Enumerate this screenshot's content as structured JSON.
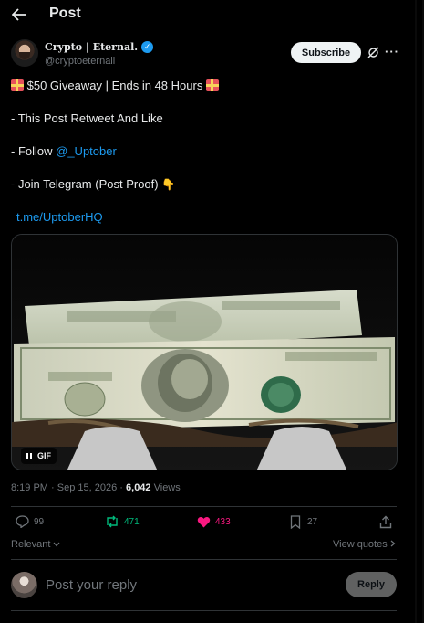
{
  "header": {
    "title": "Post",
    "back_icon": "arrow-left-icon"
  },
  "author": {
    "name": "Crypto | Eternal.",
    "handle": "@cryptoeternall",
    "verified_color": "#1d9bf0",
    "subscribe_label": "Subscribe"
  },
  "post": {
    "line1": "$50 Giveaway | Ends in 48 Hours",
    "line2": "- This Post Retweet And Like",
    "line3_prefix": "- Follow ",
    "line3_link": "@_Uptober",
    "line4": "- Join Telegram (Post Proof)",
    "line5_link": "t.me/UptoberHQ",
    "media_badge": "GIF"
  },
  "meta": {
    "time": "8:19 PM",
    "date": "Sep 15, 2026",
    "views_count": "6,042",
    "views_label": "Views"
  },
  "actions": {
    "replies": "99",
    "reposts": "471",
    "likes": "433",
    "bookmarks": "27",
    "repost_color": "#00ba7c",
    "like_color": "#f91880"
  },
  "sort": {
    "relevant_label": "Relevant",
    "view_quotes_label": "View quotes"
  },
  "reply": {
    "placeholder": "Post your reply",
    "button_label": "Reply"
  }
}
